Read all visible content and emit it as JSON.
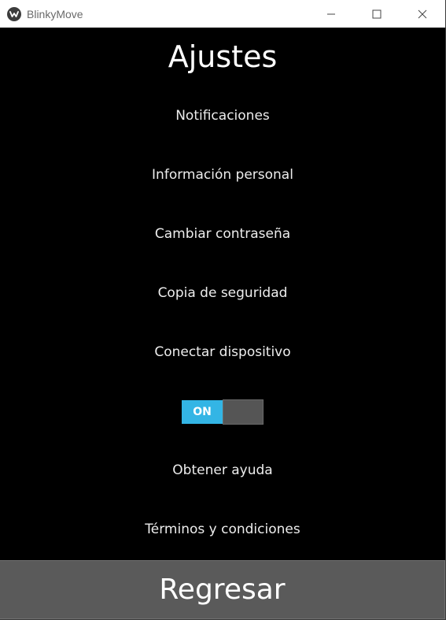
{
  "window": {
    "title": "BlinkyMove",
    "icon": "app-logo-icon"
  },
  "page": {
    "title": "Ajustes"
  },
  "menu": {
    "items": [
      {
        "label": "Notificaciones"
      },
      {
        "label": "Información personal"
      },
      {
        "label": "Cambiar contraseña"
      },
      {
        "label": "Copia de seguridad"
      },
      {
        "label": "Conectar dispositivo"
      }
    ],
    "items_after_toggle": [
      {
        "label": "Obtener ayuda"
      },
      {
        "label": "Términos y condiciones"
      }
    ]
  },
  "toggle": {
    "label": "ON",
    "state": true,
    "on_color": "#33b5e5"
  },
  "footer": {
    "back_label": "Regresar"
  }
}
